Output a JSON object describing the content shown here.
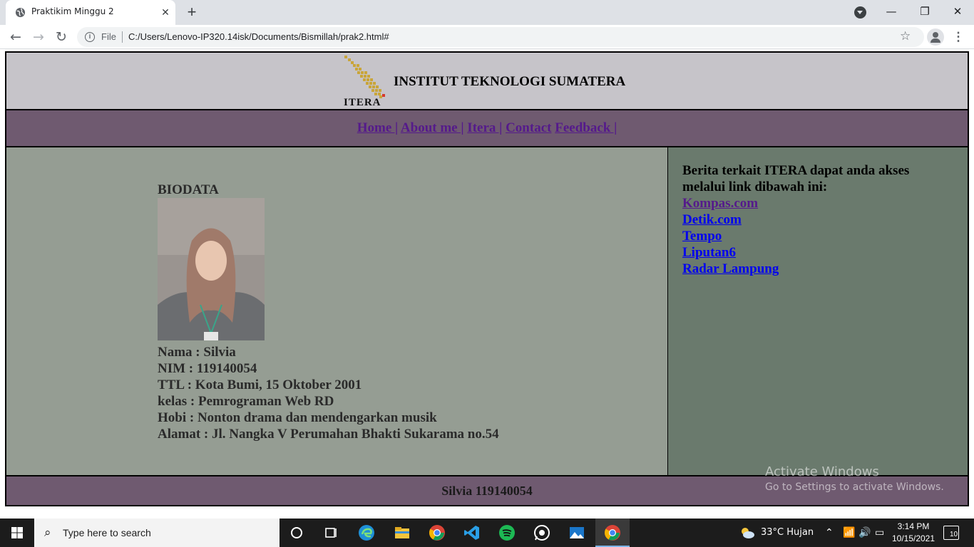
{
  "browser": {
    "tab_title": "Praktikim Minggu 2",
    "address_scheme": "File",
    "url": "C:/Users/Lenovo-IP320.14isk/Documents/Bismillah/prak2.html#"
  },
  "header": {
    "logo_text": "ITERA",
    "title": "INSTITUT TEKNOLOGI SUMATERA"
  },
  "nav": {
    "items": [
      {
        "label": "Home |"
      },
      {
        "label": "About me |"
      },
      {
        "label": "Itera |"
      },
      {
        "label": "Contact"
      },
      {
        "label": "Feedback |"
      }
    ]
  },
  "biodata": {
    "heading": "BIODATA",
    "lines": [
      "Nama : Silvia",
      "NIM : 119140054",
      "TTL : Kota Bumi, 15 Oktober 2001",
      "kelas : Pemrograman Web RD",
      "Hobi : Nonton drama dan mendengarkan musik",
      "Alamat : Jl. Nangka V Perumahan Bhakti Sukarama no.54"
    ]
  },
  "aside": {
    "intro": "Berita terkait ITERA dapat anda akses melalui link dibawah ini:",
    "links": [
      "Kompas.com",
      "Detik.com",
      "Tempo",
      "Liputan6",
      "Radar Lampung"
    ]
  },
  "footer": {
    "text": "Silvia 119140054"
  },
  "watermark": {
    "title": "Activate Windows",
    "subtitle": "Go to Settings to activate Windows."
  },
  "taskbar": {
    "search_placeholder": "Type here to search",
    "weather": "33°C  Hujan",
    "time": "3:14 PM",
    "date": "10/15/2021",
    "notification_count": "10"
  },
  "colors": {
    "header_bg": "#c6c4c9",
    "nav_bg": "#6f5a70",
    "content_bg": "#959d93",
    "aside_bg": "#6a7a6d",
    "link_visited": "#551a8b",
    "link": "#0000ee"
  }
}
